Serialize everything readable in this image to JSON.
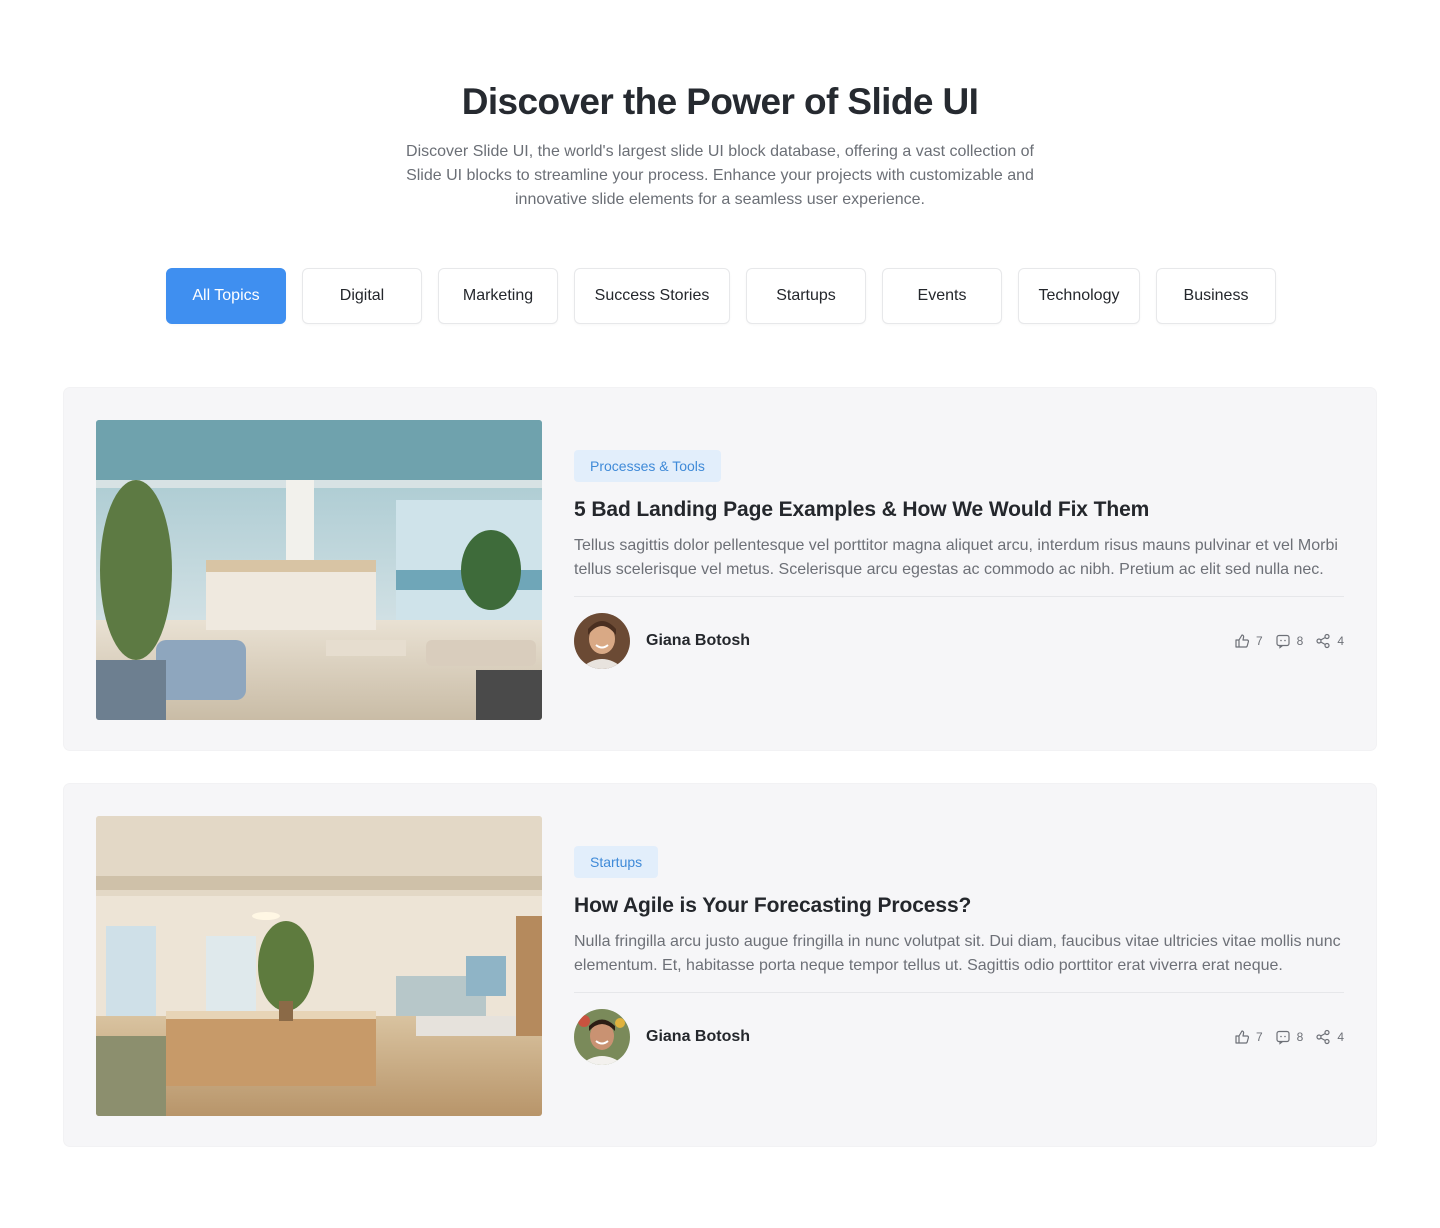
{
  "hero": {
    "title": "Discover the Power of Slide UI",
    "description": "Discover Slide UI, the world's largest slide UI block database, offering a vast collection of Slide UI blocks to streamline your process. Enhance your projects with customizable and innovative slide elements for a seamless user experience."
  },
  "topics": [
    {
      "label": "All Topics",
      "active": true
    },
    {
      "label": "Digital",
      "active": false
    },
    {
      "label": "Marketing",
      "active": false
    },
    {
      "label": "Success Stories",
      "active": false
    },
    {
      "label": "Startups",
      "active": false
    },
    {
      "label": "Events",
      "active": false
    },
    {
      "label": "Technology",
      "active": false
    },
    {
      "label": "Business",
      "active": false
    }
  ],
  "posts": [
    {
      "tag": "Processes & Tools",
      "title": "5 Bad Landing Page Examples & How We Would Fix Them",
      "excerpt": "Tellus sagittis dolor pellentesque vel porttitor magna aliquet arcu, interdum risus mauns pulvinar et vel Morbi tellus scelerisque vel metus. Scelerisque arcu egestas ac commodo ac nibh. Pretium ac elit sed nulla nec.",
      "author": "Giana Botosh",
      "likes": "7",
      "comments": "8",
      "shares": "4"
    },
    {
      "tag": "Startups",
      "title": "How Agile is Your Forecasting Process?",
      "excerpt": "Nulla fringilla arcu justo augue fringilla in nunc volutpat sit. Dui diam, faucibus vitae ultricies vitae mollis nunc elementum. Et, habitasse porta neque tempor tellus ut. Sagittis odio porttitor erat viverra erat neque.",
      "author": "Giana Botosh",
      "likes": "7",
      "comments": "8",
      "shares": "4"
    }
  ],
  "icons": {
    "like": "thumbs-up-icon",
    "comment": "comment-icon",
    "share": "share-icon"
  },
  "colors": {
    "accent": "#3f8ff0",
    "tag_bg": "#e2eefb",
    "tag_text": "#3f8ad8",
    "card_bg": "#f6f6f8"
  }
}
